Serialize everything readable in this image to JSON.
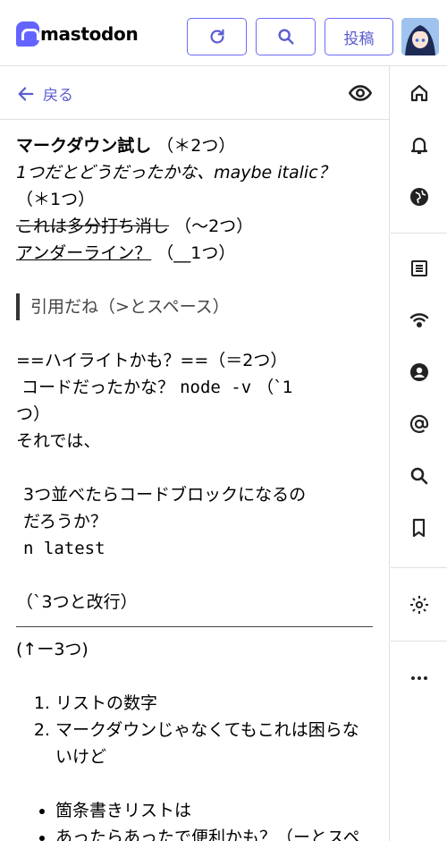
{
  "app": {
    "logo_text": "mastodon"
  },
  "header": {
    "refresh_icon": "refresh-icon",
    "search_icon": "search-icon",
    "post_label": "投稿"
  },
  "column": {
    "back_label": "戻る",
    "visibility_icon": "eye-icon"
  },
  "post": {
    "line1_bold": "マークダウン試し",
    "line1_rest": "（＊2つ）",
    "line2_italic": "1つだとどうだったかな、maybe italic？",
    "line3": "（＊1つ）",
    "line4_strike": "これは多分打ち消し",
    "line4_rest": "（～2つ）",
    "line5_under": "アンダーライン？",
    "line5_rest": "（__1つ）",
    "quote": "引用だね（>とスペース）",
    "line6": "==ハイライトかも？==（＝2つ）",
    "line7_text": "コードだったかな？",
    "line7_code": "node -v",
    "line7_rest": "（`1",
    "line8": "つ）",
    "line9": "それでは、",
    "codeblock_1": "3つ並べたらコードブロックになるの",
    "codeblock_2": "だろうか？",
    "codeblock_3": "n latest",
    "line10": "（`3つと改行）",
    "line11": "(↑ー3つ)",
    "ordered": [
      "リストの数字",
      "マークダウンじゃなくてもこれは困らないけど"
    ],
    "bullets": [
      "箇条書きリストは",
      "あったらあったで便利かも？（ーとスペース）"
    ]
  },
  "nav": {
    "items": [
      "home-icon",
      "notifications-icon",
      "explore-icon",
      "lists-icon",
      "live-feeds-icon",
      "profile-icon",
      "mentions-icon",
      "search-icon",
      "bookmarks-icon",
      "settings-icon",
      "more-icon"
    ]
  },
  "colors": {
    "accent": "#6364ff",
    "link": "#5b5cd0",
    "border": "#e0e0e0"
  }
}
